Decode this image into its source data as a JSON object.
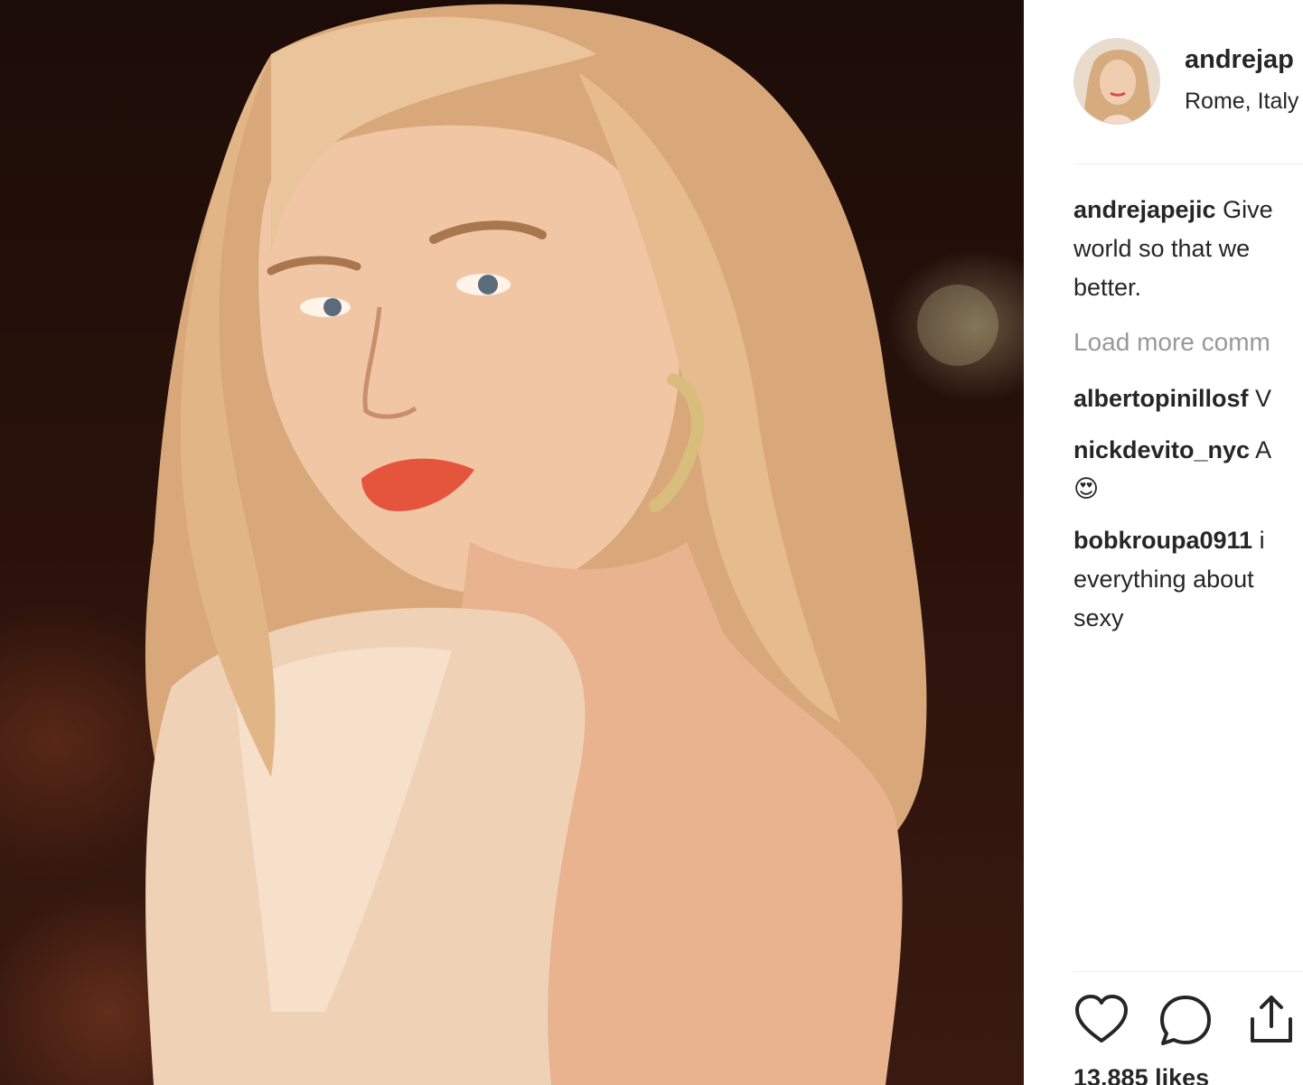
{
  "post": {
    "username": "andrejap",
    "location": "Rome, Italy"
  },
  "caption": {
    "username": "andrejapejic",
    "line1": "Give",
    "line2": "world so that we",
    "line3": "better."
  },
  "load_more": "Load more comm",
  "comments": [
    {
      "username": "albertopinillosf",
      "text": "V"
    },
    {
      "username": "nickdevito_nyc",
      "text": "A",
      "line2": "😍"
    },
    {
      "username": "bobkroupa0911",
      "text": "i",
      "line2": "everything about",
      "line3": "sexy"
    }
  ],
  "likes": "13,885 likes",
  "icons": {
    "like": "heart-icon",
    "comment": "comment-bubble-icon",
    "share": "share-icon"
  },
  "colors": {
    "text": "#262626",
    "muted": "#999999",
    "divider": "#efefef",
    "background": "#ffffff"
  }
}
